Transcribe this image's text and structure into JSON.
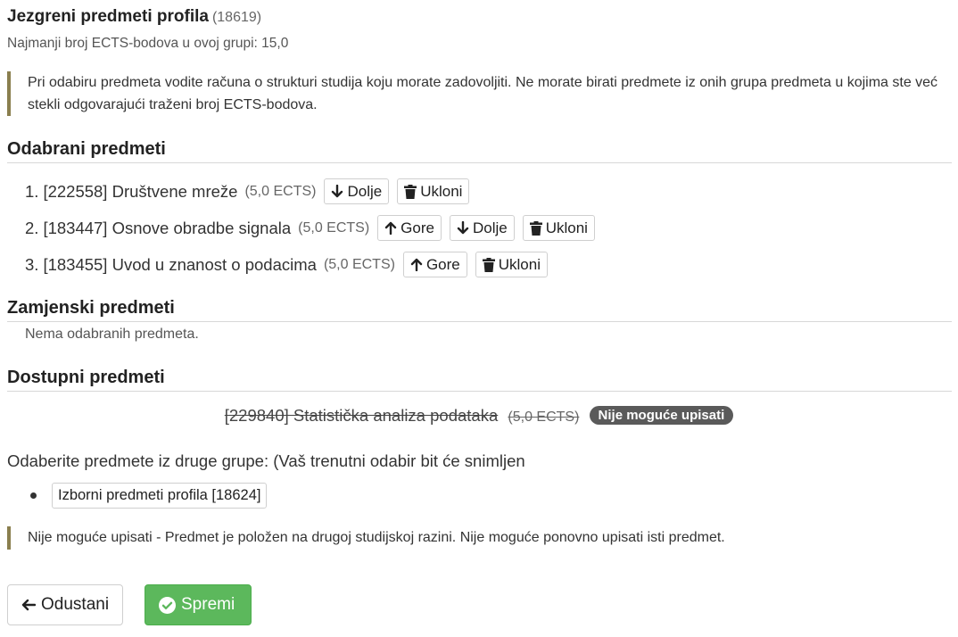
{
  "group": {
    "title": "Jezgreni predmeti profila",
    "code": "(18619)",
    "min_ects": "Najmanji broj ECTS-bodova u ovoj grupi: 15,0"
  },
  "notice": "Pri odabiru predmeta vodite računa o strukturi studija koju morate zadovoljiti. Ne morate birati predmete iz onih grupa predmeta u kojima ste već stekli odgovarajući traženi broj ECTS-bodova.",
  "selected": {
    "title": "Odabrani predmeti",
    "items": [
      {
        "num": "1.",
        "name": "[222558] Društvene mreže",
        "ects": "(5,0 ECTS)"
      },
      {
        "num": "2.",
        "name": "[183447] Osnove obradbe signala",
        "ects": "(5,0 ECTS)"
      },
      {
        "num": "3.",
        "name": "[183455] Uvod u znanost o podacima",
        "ects": "(5,0 ECTS)"
      }
    ],
    "up_label": "Gore",
    "down_label": "Dolje",
    "remove_label": "Ukloni"
  },
  "replacement": {
    "title": "Zamjenski predmeti",
    "empty": "Nema odabranih predmeta."
  },
  "available": {
    "title": "Dostupni predmeti",
    "item": {
      "name": "[229840] Statistička analiza podataka",
      "ects": "(5,0 ECTS)",
      "badge": "Nije moguće upisati"
    }
  },
  "other_groups": {
    "text": "Odaberite predmete iz druge grupe: (Vaš trenutni odabir bit će snimljen",
    "items": [
      "Izborni predmeti profila [18624]"
    ]
  },
  "footnote": "Nije moguće upisati - Predmet je položen na drugoj studijskoj razini. Nije moguće ponovno upisati isti predmet.",
  "actions": {
    "cancel": "Odustani",
    "save": "Spremi"
  },
  "colors": {
    "note_border": "#8a7f4e",
    "badge": "#5a5a5a",
    "save": "#5cb85c"
  }
}
